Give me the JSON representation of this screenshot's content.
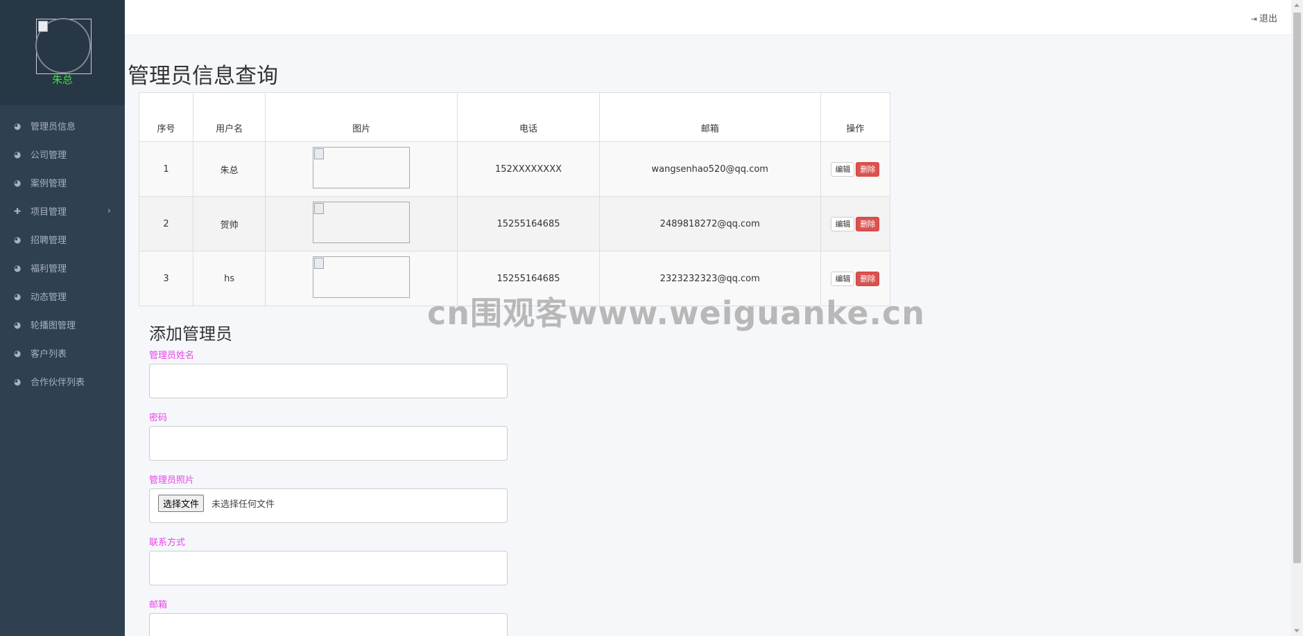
{
  "sidebar": {
    "user_name": "朱总",
    "items": [
      {
        "label": "管理员信息",
        "icon": "dashboard-icon"
      },
      {
        "label": "公司管理",
        "icon": "dashboard-icon"
      },
      {
        "label": "案例管理",
        "icon": "dashboard-icon"
      },
      {
        "label": "项目管理",
        "icon": "pin-icon",
        "arrow": "›"
      },
      {
        "label": "招聘管理",
        "icon": "dashboard-icon"
      },
      {
        "label": "福利管理",
        "icon": "dashboard-icon"
      },
      {
        "label": "动态管理",
        "icon": "dashboard-icon"
      },
      {
        "label": "轮播图管理",
        "icon": "dashboard-icon"
      },
      {
        "label": "客户列表",
        "icon": "dashboard-icon"
      },
      {
        "label": "合作伙伴列表",
        "icon": "dashboard-icon"
      }
    ]
  },
  "topbar": {
    "logout_label": "退出"
  },
  "main": {
    "title": "管理员信息查询",
    "table": {
      "headers": [
        "序号",
        "用户名",
        "图片",
        "电话",
        "邮箱",
        "操作"
      ],
      "rows": [
        {
          "index": "1",
          "username": "朱总",
          "phone": "152XXXXXXXX",
          "email": "wangsenhao520@qq.com"
        },
        {
          "index": "2",
          "username": "贺帅",
          "phone": "15255164685",
          "email": "2489818272@qq.com"
        },
        {
          "index": "3",
          "username": "hs",
          "phone": "15255164685",
          "email": "2323232323@qq.com"
        }
      ],
      "edit_label": "编辑",
      "delete_label": "删除"
    },
    "watermark": "cn围观客www.weiguanke.cn",
    "form": {
      "title": "添加管理员",
      "name_label": "管理员姓名",
      "password_label": "密码",
      "photo_label": "管理员照片",
      "file_button": "选择文件",
      "file_status": "未选择任何文件",
      "contact_label": "联系方式",
      "email_label": "邮箱"
    }
  },
  "colors": {
    "sidebar_bg": "#2f4050",
    "profile_name": "#3ae03a",
    "form_label": "#e844e8",
    "danger": "#d9534f"
  }
}
